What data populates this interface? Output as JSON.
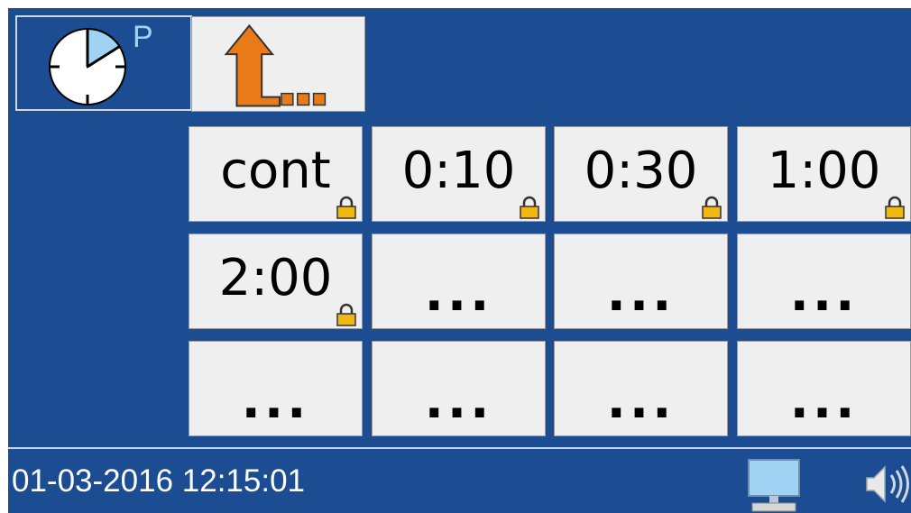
{
  "toolbar": {
    "mode_icon": "clock-program-icon",
    "mode_letter": "P",
    "up_icon": "arrow-up-back-icon"
  },
  "grid": {
    "buttons": [
      {
        "label": "cont",
        "locked": true
      },
      {
        "label": "0:10",
        "locked": true
      },
      {
        "label": "0:30",
        "locked": true
      },
      {
        "label": "1:00",
        "locked": true
      },
      {
        "label": "2:00",
        "locked": true
      },
      {
        "label": "...",
        "locked": false
      },
      {
        "label": "...",
        "locked": false
      },
      {
        "label": "...",
        "locked": false
      },
      {
        "label": "...",
        "locked": false
      },
      {
        "label": "...",
        "locked": false
      },
      {
        "label": "...",
        "locked": false
      },
      {
        "label": "...",
        "locked": false
      }
    ]
  },
  "status": {
    "datetime": "01-03-2016 12:15:01",
    "monitor_icon": "monitor-icon",
    "speaker_icon": "speaker-icon"
  },
  "colors": {
    "background": "#1c4c91",
    "button": "#efefef",
    "accent_orange": "#e87a17",
    "lock_gold": "#f2b713",
    "clock_slice": "#9fd2f3"
  }
}
